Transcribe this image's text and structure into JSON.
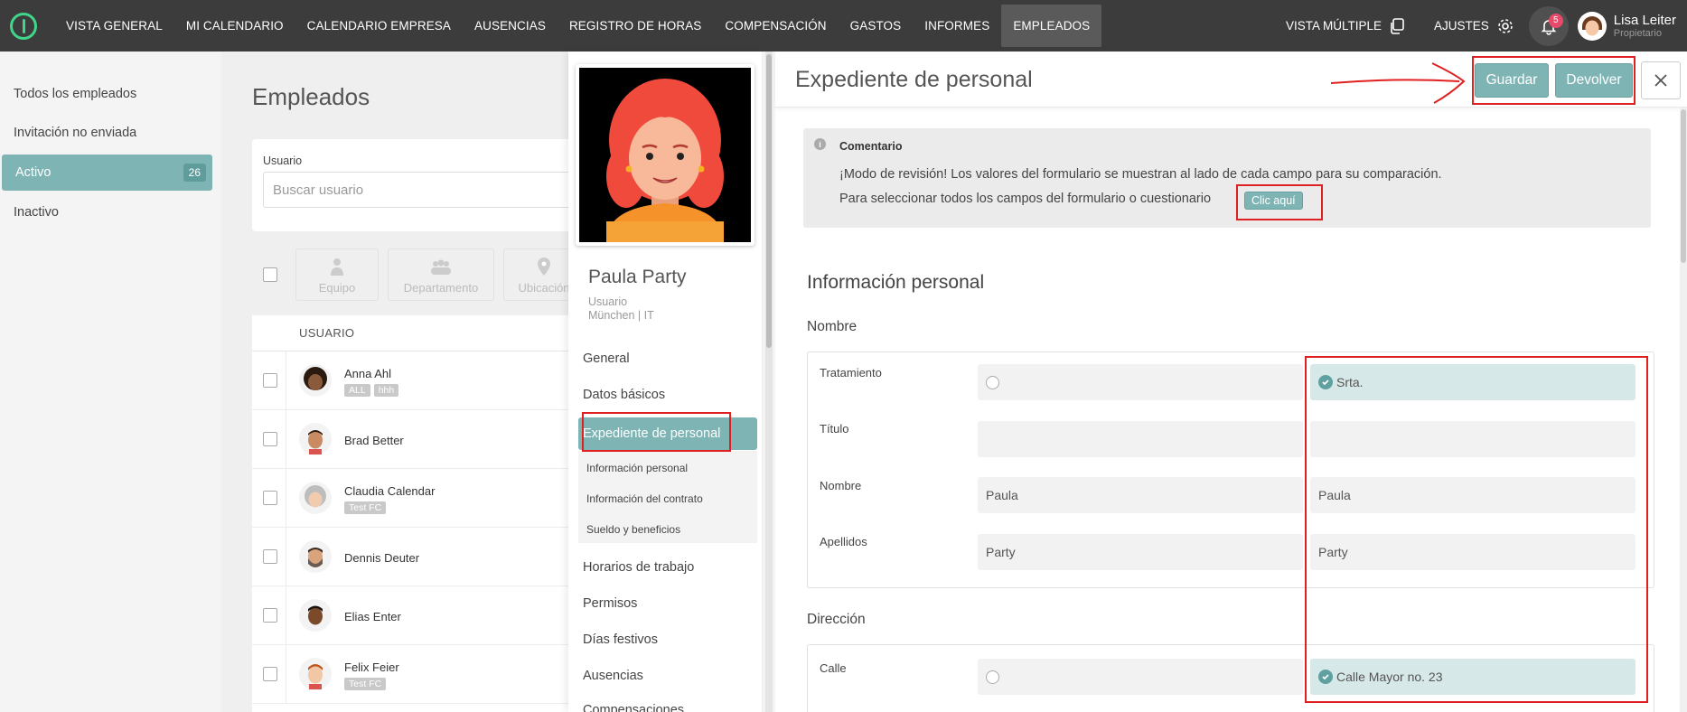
{
  "nav": {
    "items": [
      "VISTA GENERAL",
      "MI CALENDARIO",
      "CALENDARIO EMPRESA",
      "AUSENCIAS",
      "REGISTRO DE HORAS",
      "COMPENSACIÓN",
      "GASTOS",
      "INFORMES",
      "EMPLEADOS"
    ],
    "active": "EMPLEADOS",
    "multi_view": "VISTA MÚLTIPLE",
    "settings": "AJUSTES",
    "notifications": "5",
    "user_name": "Lisa Leiter",
    "user_role": "Propietario"
  },
  "sidebar": {
    "items": [
      {
        "label": "Todos los empleados"
      },
      {
        "label": "Invitación no enviada"
      },
      {
        "label": "Activo",
        "count": "26"
      },
      {
        "label": "Inactivo"
      }
    ]
  },
  "employees": {
    "title": "Empleados",
    "search_label": "Usuario",
    "search_placeholder": "Buscar usuario",
    "filters": [
      "Equipo",
      "Departamento",
      "Ubicación"
    ],
    "column": "USUARIO",
    "rows": [
      {
        "name": "Anna Ahl",
        "tags": [
          "ALL",
          "hhh"
        ]
      },
      {
        "name": "Brad Better",
        "tags": []
      },
      {
        "name": "Claudia Calendar",
        "tags": [
          "Test FC"
        ]
      },
      {
        "name": "Dennis Deuter",
        "tags": []
      },
      {
        "name": "Elias Enter",
        "tags": []
      },
      {
        "name": "Felix Feier",
        "tags": [
          "Test FC"
        ]
      }
    ]
  },
  "profile": {
    "name": "Paula Party",
    "role": "Usuario",
    "location": "München | IT",
    "menu": [
      "General",
      "Datos básicos",
      "Expediente de personal",
      "Horarios de trabajo",
      "Permisos",
      "Días festivos",
      "Ausencias",
      "Compensaciones"
    ],
    "submenu": [
      "Información personal",
      "Información del contrato",
      "Sueldo y beneficios"
    ]
  },
  "record": {
    "title": "Expediente de personal",
    "save": "Guardar",
    "return": "Devolver",
    "comment_title": "Comentario",
    "comment_line1": "¡Modo de revisión! Los valores del formulario se muestran al lado de cada campo para su comparación.",
    "comment_line2": "Para seleccionar todos los campos del formulario o cuestionario",
    "click_here": "Clic aquí",
    "section": "Información personal",
    "group_name": "Nombre",
    "group_address": "Dirección",
    "fields": [
      {
        "label": "Tratamiento",
        "current": "",
        "proposed": "Srta."
      },
      {
        "label": "Título",
        "current": "",
        "proposed": ""
      },
      {
        "label": "Nombre",
        "current": "Paula",
        "proposed": "Paula"
      },
      {
        "label": "Apellidos",
        "current": "Party",
        "proposed": "Party"
      }
    ],
    "address_fields": [
      {
        "label": "Calle",
        "current": "",
        "proposed": "Calle Mayor no. 23"
      }
    ]
  },
  "colors": {
    "accent": "#7fb4b4",
    "nav_bg": "#3c3c3c",
    "annotation": "#e02020"
  }
}
